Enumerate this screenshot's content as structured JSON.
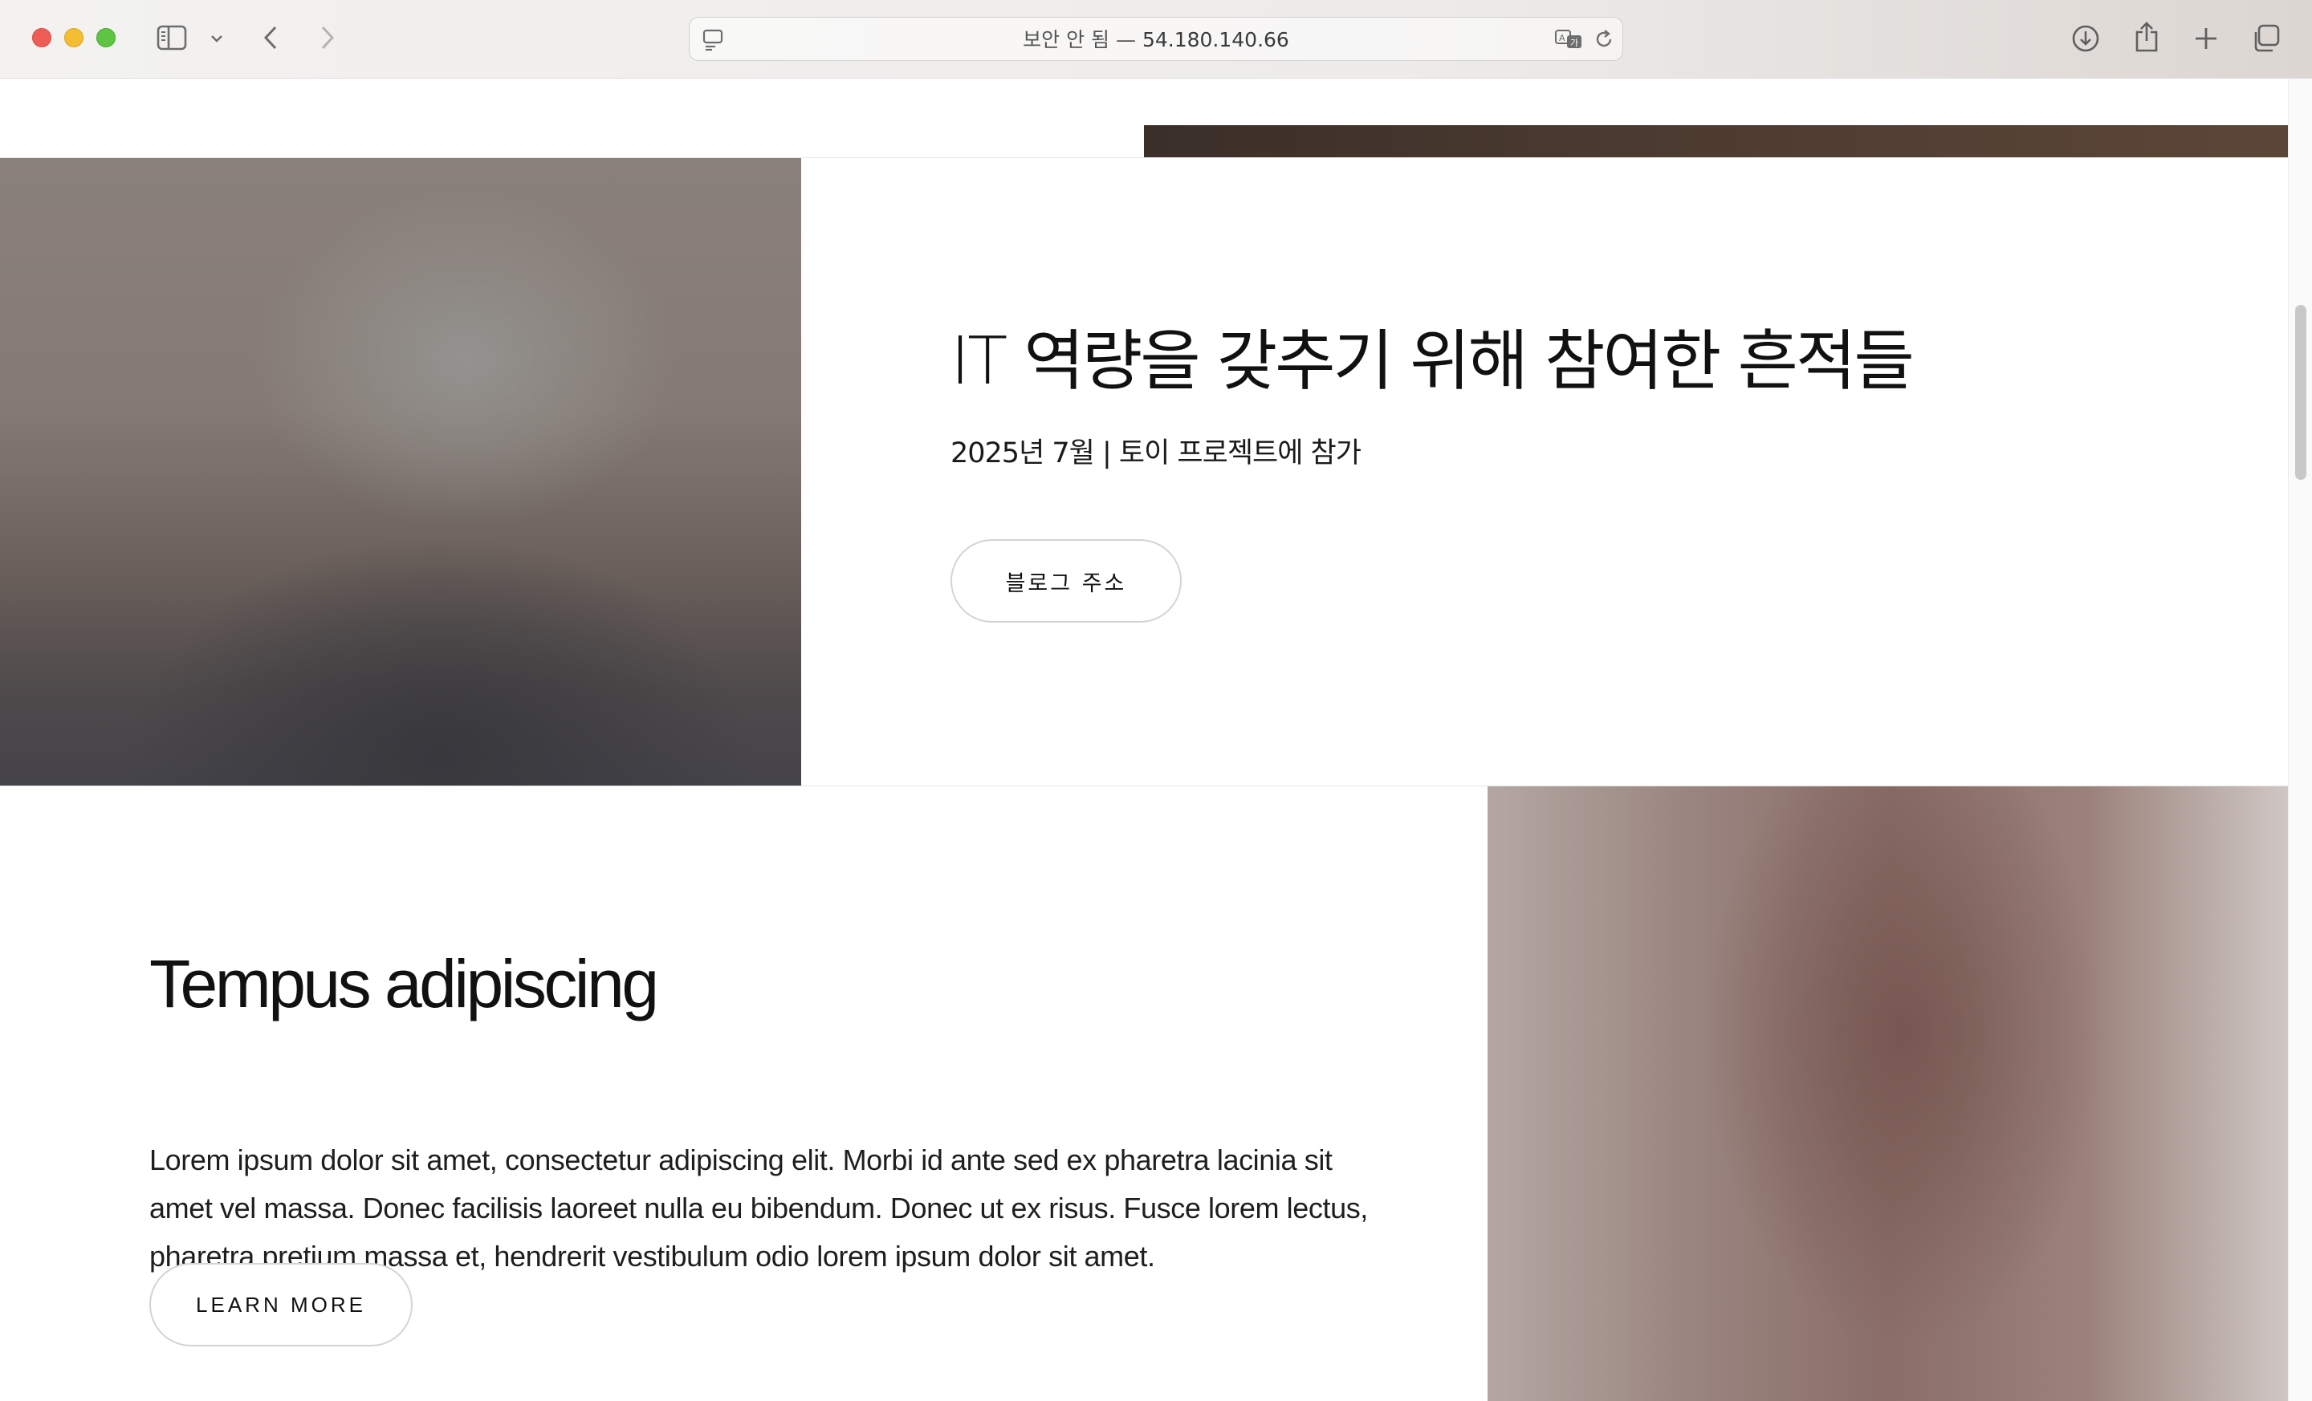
{
  "browser": {
    "url_security": "보안 안 됨 —",
    "url_host": "54.180.140.66",
    "icons": {
      "sidebar": "sidebar-icon",
      "sidebar_menu": "chevron-down-icon",
      "back": "chevron-left-icon",
      "forward": "chevron-right-icon",
      "page_menu": "page-menu-icon",
      "translate": "translate-icon",
      "reload": "reload-icon",
      "downloads": "download-icon",
      "share": "share-icon",
      "new_tab": "plus-icon",
      "tab_overview": "tabs-icon"
    }
  },
  "section_one": {
    "title": "IT 역량을 갖추기 위해 참여한 흔적들",
    "subtitle": "2025년 7월 | 토이 프로젝트에 참가",
    "button_label": "블로그 주소"
  },
  "section_two": {
    "title": "Tempus adipiscing",
    "body_lines": [
      "Lorem ipsum dolor sit amet, consectetur adipiscing elit. Morbi id ante sed ex pharetra lacinia sit",
      "amet vel massa. Donec facilisis laoreet nulla eu bibendum. Donec ut ex risus. Fusce lorem lectus,",
      "pharetra pretium massa et, hendrerit vestibulum odio lorem ipsum dolor sit amet."
    ],
    "button_label": "LEARN MORE"
  },
  "colors": {
    "traffic_red": "#ee5e57",
    "traffic_yellow": "#f5bd31",
    "traffic_green": "#5ec441",
    "text": "#111111",
    "button_border": "#d4d4d4"
  }
}
